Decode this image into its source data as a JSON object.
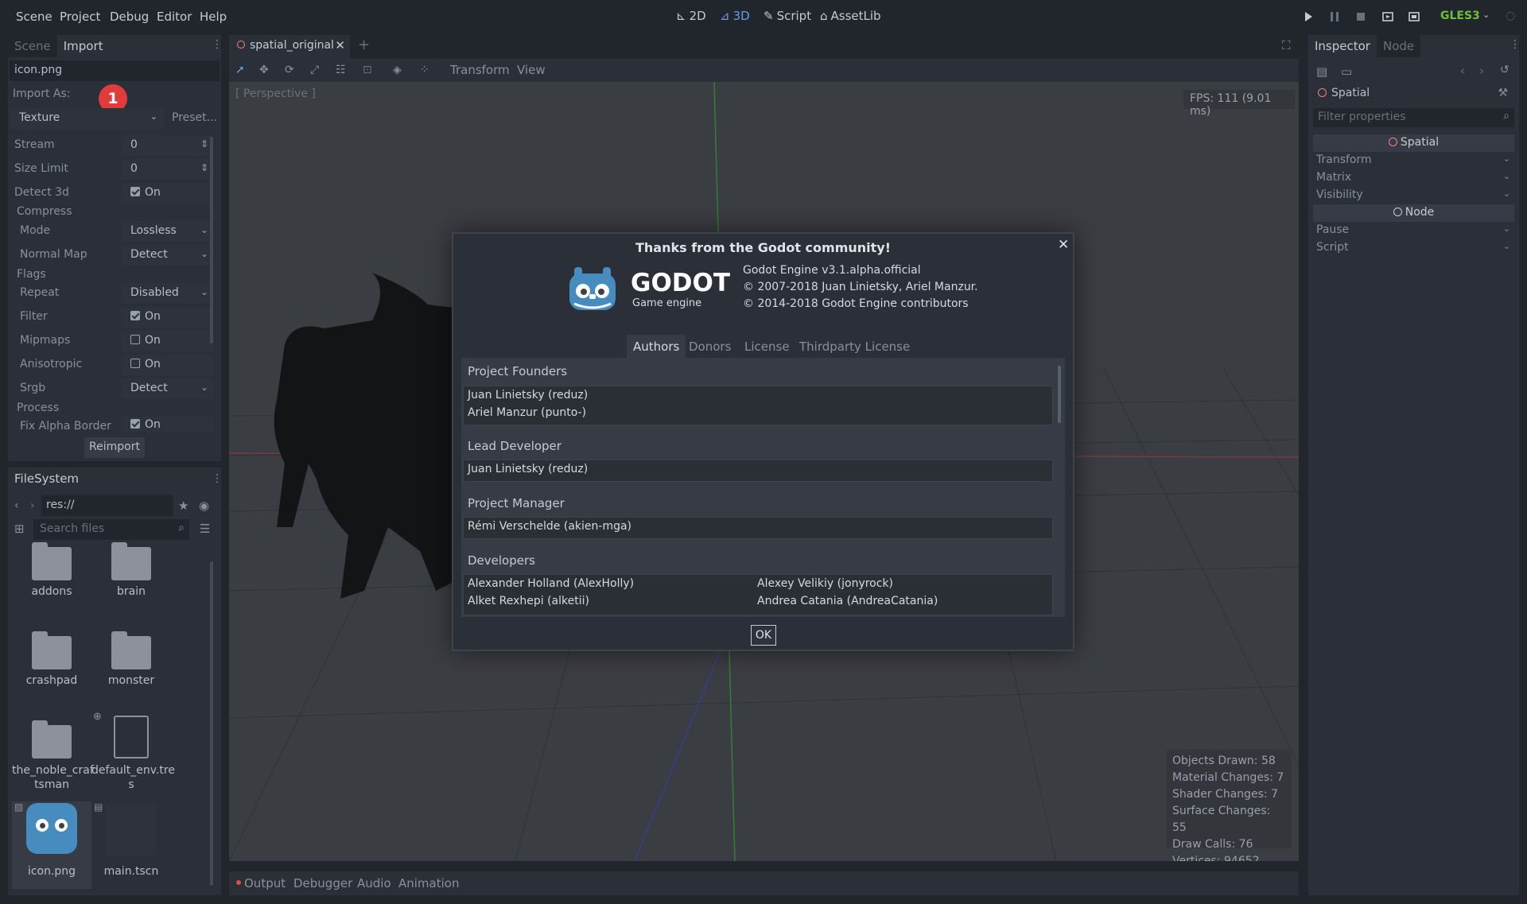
{
  "menu": [
    "Scene",
    "Project",
    "Debug",
    "Editor",
    "Help"
  ],
  "modes": [
    {
      "label": "2D",
      "active": false
    },
    {
      "label": "3D",
      "active": true
    },
    {
      "label": "Script",
      "active": false
    },
    {
      "label": "AssetLib",
      "active": false
    }
  ],
  "renderer": "GLES3",
  "left_dock": {
    "tabs": [
      "Scene",
      "Import"
    ],
    "active_tab": "Import",
    "file_name": "icon.png",
    "import_as_label": "Import As:",
    "badge": "1",
    "import_type": "Texture",
    "preset_label": "Preset...",
    "props": {
      "stream": {
        "label": "Stream",
        "value": "0"
      },
      "size_limit": {
        "label": "Size Limit",
        "value": "0"
      },
      "detect_3d": {
        "label": "Detect 3d",
        "value": "On"
      },
      "compress_section": "Compress",
      "mode": {
        "label": "Mode",
        "value": "Lossless"
      },
      "normal_map": {
        "label": "Normal Map",
        "value": "Detect"
      },
      "flags_section": "Flags",
      "repeat": {
        "label": "Repeat",
        "value": "Disabled"
      },
      "filter": {
        "label": "Filter",
        "value": "On"
      },
      "mipmaps": {
        "label": "Mipmaps",
        "value": "On"
      },
      "anisotropic": {
        "label": "Anisotropic",
        "value": "On"
      },
      "srgb": {
        "label": "Srgb",
        "value": "Detect"
      },
      "process_section": "Process",
      "fix_alpha_border": {
        "label": "Fix Alpha Border",
        "value": "On"
      }
    },
    "reimport_label": "Reimport"
  },
  "filesystem": {
    "title": "FileSystem",
    "path": "res://",
    "search_placeholder": "Search files",
    "items": {
      "addons": "addons",
      "brain": "brain",
      "crashpad": "crashpad",
      "monster": "monster",
      "noble": "the_noble_craf\ntsman",
      "env": "default_env.tre\ns",
      "icon": "icon.png",
      "main": "main.tscn"
    }
  },
  "scene_tab": "spatial_original",
  "viewport_toolbar": {
    "transform": "Transform",
    "view": "View"
  },
  "viewport": {
    "perspective_label": "[ Perspective ]",
    "fps": "FPS: 111 (9.01 ms)",
    "stats": {
      "objects": "Objects Drawn: 58",
      "material": "Material Changes: 7",
      "shader": "Shader Changes: 7",
      "surface": "Surface Changes: 55",
      "draw": "Draw Calls: 76",
      "vertices": "Vertices: 94652"
    }
  },
  "dialog": {
    "title": "Thanks from the Godot community!",
    "logo_text": "GODOT",
    "logo_sub": "Game engine",
    "version": "Godot Engine v3.1.alpha.official",
    "copyright1": "© 2007-2018 Juan Linietsky, Ariel Manzur.",
    "copyright2": "© 2014-2018 Godot Engine contributors",
    "tabs": [
      "Authors",
      "Donors",
      "License",
      "Thirdparty License"
    ],
    "sections": {
      "founders_title": "Project Founders",
      "founders": [
        "Juan Linietsky (reduz)",
        "Ariel Manzur (punto-)"
      ],
      "lead_title": "Lead Developer",
      "lead": "Juan Linietsky (reduz)",
      "pm_title": "Project Manager",
      "pm": "Rémi Verschelde (akien-mga)",
      "devs_title": "Developers",
      "devs": [
        "Alexander Holland (AlexHolly)",
        "Alexey Velikiy (jonyrock)",
        "Alket Rexhepi (alketii)",
        "Andrea Catania (AndreaCatania)"
      ]
    },
    "ok_label": "OK"
  },
  "bottom_panel": [
    "Output",
    "Debugger",
    "Audio",
    "Animation"
  ],
  "inspector": {
    "tabs": [
      "Inspector",
      "Node"
    ],
    "node_name": "Spatial",
    "filter_placeholder": "Filter properties",
    "spatial_header": "Spatial",
    "spatial_props": [
      "Transform",
      "Matrix",
      "Visibility"
    ],
    "node_header": "Node",
    "node_props": [
      "Pause",
      "Script"
    ]
  }
}
